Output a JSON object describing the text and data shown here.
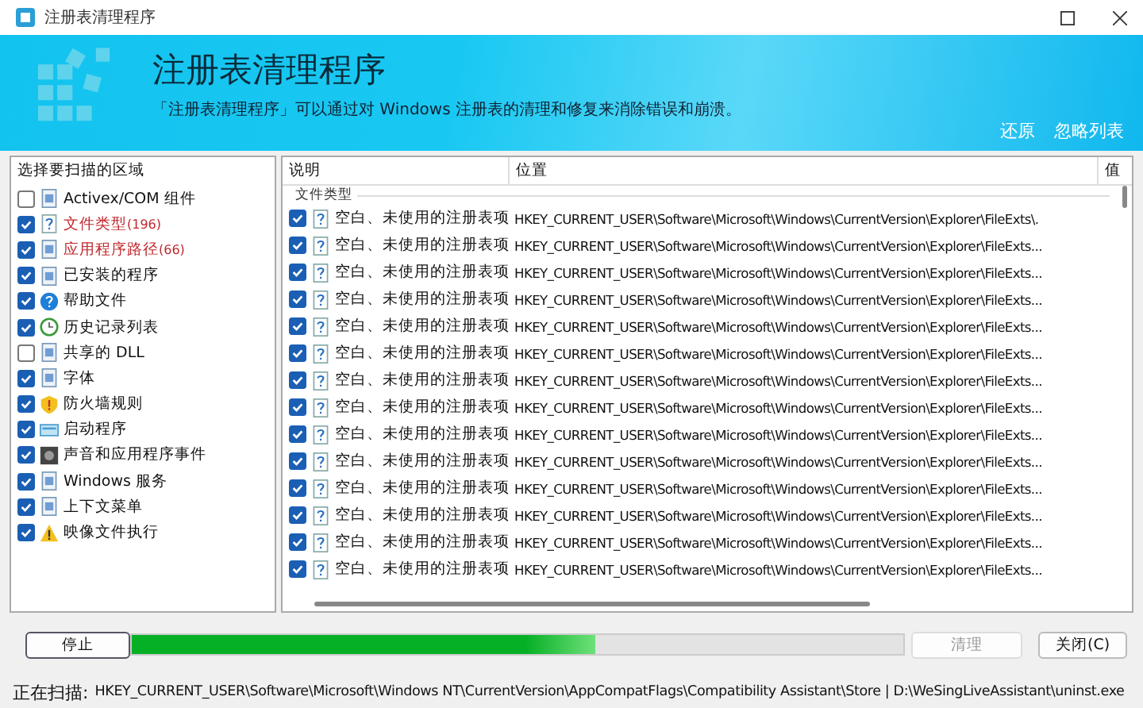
{
  "window": {
    "title": "注册表清理程序"
  },
  "banner": {
    "heading": "注册表清理程序",
    "description": "「注册表清理程序」可以通过对 Windows 注册表的清理和修复来消除错误和崩溃。",
    "links": [
      "还原",
      "忽略列表"
    ]
  },
  "areas": {
    "title": "选择要扫描的区域",
    "items": [
      {
        "label": "Activex/COM 组件",
        "checked": false,
        "highlight": false
      },
      {
        "label": "文件类型",
        "count": "(196)",
        "checked": true,
        "highlight": true
      },
      {
        "label": "应用程序路径",
        "count": "(66)",
        "checked": true,
        "highlight": true
      },
      {
        "label": "已安装的程序",
        "checked": true,
        "highlight": false
      },
      {
        "label": "帮助文件",
        "checked": true,
        "highlight": false
      },
      {
        "label": "历史记录列表",
        "checked": true,
        "highlight": false
      },
      {
        "label": "共享的 DLL",
        "checked": false,
        "highlight": false
      },
      {
        "label": "字体",
        "checked": true,
        "highlight": false
      },
      {
        "label": "防火墙规则",
        "checked": true,
        "highlight": false
      },
      {
        "label": "启动程序",
        "checked": true,
        "highlight": false
      },
      {
        "label": "声音和应用程序事件",
        "checked": true,
        "highlight": false
      },
      {
        "label": "Windows 服务",
        "checked": true,
        "highlight": false
      },
      {
        "label": "上下文菜单",
        "checked": true,
        "highlight": false
      },
      {
        "label": "映像文件执行",
        "checked": true,
        "highlight": false
      }
    ]
  },
  "table": {
    "columns": [
      "说明",
      "位置",
      "值"
    ],
    "group": "文件类型",
    "rows": [
      {
        "checked": true,
        "description": "空白、未使用的注册表项",
        "location": "HKEY_CURRENT_USER\\Software\\Microsoft\\Windows\\CurrentVersion\\Explorer\\FileExts\\."
      },
      {
        "checked": true,
        "description": "空白、未使用的注册表项",
        "location": "HKEY_CURRENT_USER\\Software\\Microsoft\\Windows\\CurrentVersion\\Explorer\\FileExts..."
      },
      {
        "checked": true,
        "description": "空白、未使用的注册表项",
        "location": "HKEY_CURRENT_USER\\Software\\Microsoft\\Windows\\CurrentVersion\\Explorer\\FileExts..."
      },
      {
        "checked": true,
        "description": "空白、未使用的注册表项",
        "location": "HKEY_CURRENT_USER\\Software\\Microsoft\\Windows\\CurrentVersion\\Explorer\\FileExts..."
      },
      {
        "checked": true,
        "description": "空白、未使用的注册表项",
        "location": "HKEY_CURRENT_USER\\Software\\Microsoft\\Windows\\CurrentVersion\\Explorer\\FileExts..."
      },
      {
        "checked": true,
        "description": "空白、未使用的注册表项",
        "location": "HKEY_CURRENT_USER\\Software\\Microsoft\\Windows\\CurrentVersion\\Explorer\\FileExts..."
      },
      {
        "checked": true,
        "description": "空白、未使用的注册表项",
        "location": "HKEY_CURRENT_USER\\Software\\Microsoft\\Windows\\CurrentVersion\\Explorer\\FileExts..."
      },
      {
        "checked": true,
        "description": "空白、未使用的注册表项",
        "location": "HKEY_CURRENT_USER\\Software\\Microsoft\\Windows\\CurrentVersion\\Explorer\\FileExts..."
      },
      {
        "checked": true,
        "description": "空白、未使用的注册表项",
        "location": "HKEY_CURRENT_USER\\Software\\Microsoft\\Windows\\CurrentVersion\\Explorer\\FileExts..."
      },
      {
        "checked": true,
        "description": "空白、未使用的注册表项",
        "location": "HKEY_CURRENT_USER\\Software\\Microsoft\\Windows\\CurrentVersion\\Explorer\\FileExts..."
      },
      {
        "checked": true,
        "description": "空白、未使用的注册表项",
        "location": "HKEY_CURRENT_USER\\Software\\Microsoft\\Windows\\CurrentVersion\\Explorer\\FileExts..."
      },
      {
        "checked": true,
        "description": "空白、未使用的注册表项",
        "location": "HKEY_CURRENT_USER\\Software\\Microsoft\\Windows\\CurrentVersion\\Explorer\\FileExts..."
      },
      {
        "checked": true,
        "description": "空白、未使用的注册表项",
        "location": "HKEY_CURRENT_USER\\Software\\Microsoft\\Windows\\CurrentVersion\\Explorer\\FileExts..."
      },
      {
        "checked": true,
        "description": "空白、未使用的注册表项",
        "location": "HKEY_CURRENT_USER\\Software\\Microsoft\\Windows\\CurrentVersion\\Explorer\\FileExts..."
      }
    ]
  },
  "actions": {
    "stop": "停止",
    "progress": {
      "level": 0.6
    },
    "clean": {
      "label": "清理",
      "disabled": true
    },
    "close": "关闭(C)"
  },
  "status_bar": {
    "label": "正在扫描:",
    "path": "HKEY_CURRENT_USER\\Software\\Microsoft\\Windows NT\\CurrentVersion\\AppCompatFlags\\Compatibility Assistant\\Store | D:\\WeSingLiveAssistant\\uninst.exe"
  }
}
